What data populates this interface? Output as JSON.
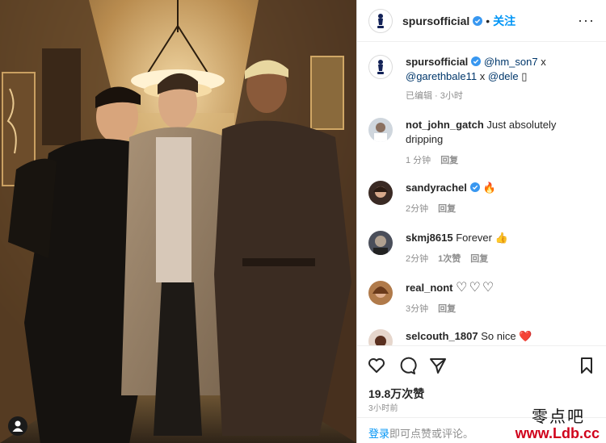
{
  "header": {
    "username": "spursofficial",
    "separator": "•",
    "follow_label": "关注",
    "more_label": "···"
  },
  "caption": {
    "username": "spursofficial",
    "text_before": " ",
    "mention1": "@hm_son7",
    "sep1": " x ",
    "mention2": "@garethbale11",
    "sep2": " x ",
    "mention3": "@dele",
    "trailing": " ▯",
    "edited": "已编辑 · 3小时"
  },
  "comments": [
    {
      "username": "not_john_gatch",
      "text": "Just absolutely dripping",
      "time": "1 分钟",
      "reply": "回复"
    },
    {
      "username": "sandyrachel",
      "text": "🔥",
      "time": "2分钟",
      "reply": "回复"
    },
    {
      "username": "skmj8615",
      "text": "Forever 👍",
      "time": "2分钟",
      "likes": "1次赞",
      "reply": "回复"
    },
    {
      "username": "real_nont",
      "text": "♡♡♡",
      "time": "3分钟",
      "reply": "回复"
    },
    {
      "username": "selcouth_1807",
      "text": "So nice ❤️"
    }
  ],
  "likes": "19.8万次赞",
  "time_ago": "3小时前",
  "login": {
    "link": "登录",
    "rest": "即可点赞或评论。"
  },
  "watermark": {
    "line1": "零点吧",
    "line2": "www.Ldb.cc"
  },
  "colors": {
    "accent": "#0095f6",
    "verified": "#3897f0",
    "heart": "#ed4956"
  }
}
